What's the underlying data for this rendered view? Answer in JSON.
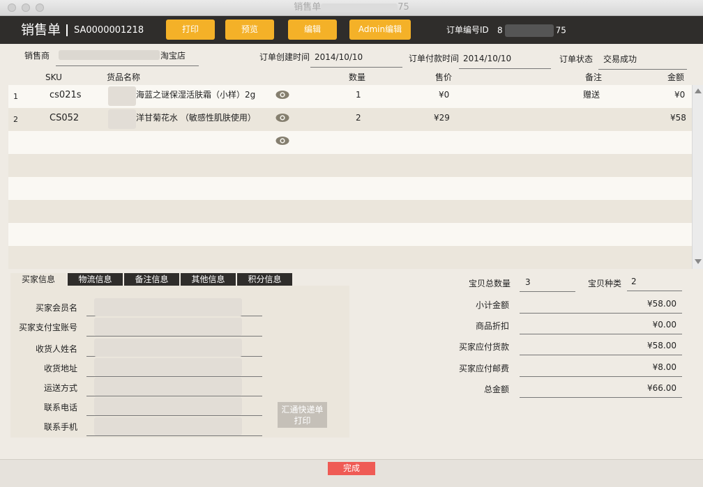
{
  "window": {
    "title_prefix": "销售单",
    "title_suffix": "75"
  },
  "header": {
    "title": "销售单",
    "order_no": "SA0000001218",
    "buttons": {
      "print": "打印",
      "preview": "预览",
      "edit": "编辑",
      "admin_edit": "Admin编辑"
    },
    "order_id_label": "订单编号ID",
    "order_id_prefix": "8",
    "order_id_suffix": "75"
  },
  "order": {
    "seller_label": "销售商",
    "seller_suffix": "淘宝店",
    "created_label": "订单创建时间",
    "created_value": "2014/10/10",
    "paid_label": "订单付款时间",
    "paid_value": "2014/10/10",
    "status_label": "订单状态",
    "status_value": "交易成功"
  },
  "table": {
    "headers": {
      "sku": "SKU",
      "name": "货品名称",
      "qty": "数量",
      "price": "售价",
      "note": "备注",
      "amount": "金额"
    },
    "rows": [
      {
        "index": "1",
        "sku": "cs021s",
        "name": "海蓝之谜保湿活肤霜（小样）2g",
        "qty": "1",
        "price": "¥0",
        "note": "赠送",
        "amount": "¥0"
      },
      {
        "index": "2",
        "sku": "CS052",
        "name": "洋甘菊花水 （敏感性肌肤使用）",
        "qty": "2",
        "price": "¥29",
        "note": "",
        "amount": "¥58"
      }
    ]
  },
  "tabs": [
    "买家信息",
    "物流信息",
    "备注信息",
    "其他信息",
    "积分信息"
  ],
  "buyer": {
    "fields": [
      "买家会员名",
      "买家支付宝账号",
      "收货人姓名",
      "收货地址",
      "运送方式",
      "联系电话",
      "联系手机"
    ],
    "print_button": [
      "汇通快递单",
      "打印"
    ]
  },
  "summary": {
    "total_qty_label": "宝贝总数量",
    "total_qty": "3",
    "kinds_label": "宝贝种类",
    "kinds": "2",
    "rows": [
      {
        "label": "小计金额",
        "value": "¥58.00"
      },
      {
        "label": "商品折扣",
        "value": "¥0.00"
      },
      {
        "label": "买家应付货款",
        "value": "¥58.00"
      },
      {
        "label": "买家应付邮费",
        "value": "¥8.00"
      },
      {
        "label": "总金额",
        "value": "¥66.00"
      }
    ]
  },
  "footer": {
    "done": "完成"
  },
  "icons": {
    "eye": "eye-icon",
    "scroll_up": "scroll-up-arrow-icon",
    "scroll_down": "scroll-down-arrow-icon"
  },
  "colors": {
    "accent": "#f4b128",
    "header_bg": "#2f2d2b",
    "done": "#ef5b55"
  }
}
